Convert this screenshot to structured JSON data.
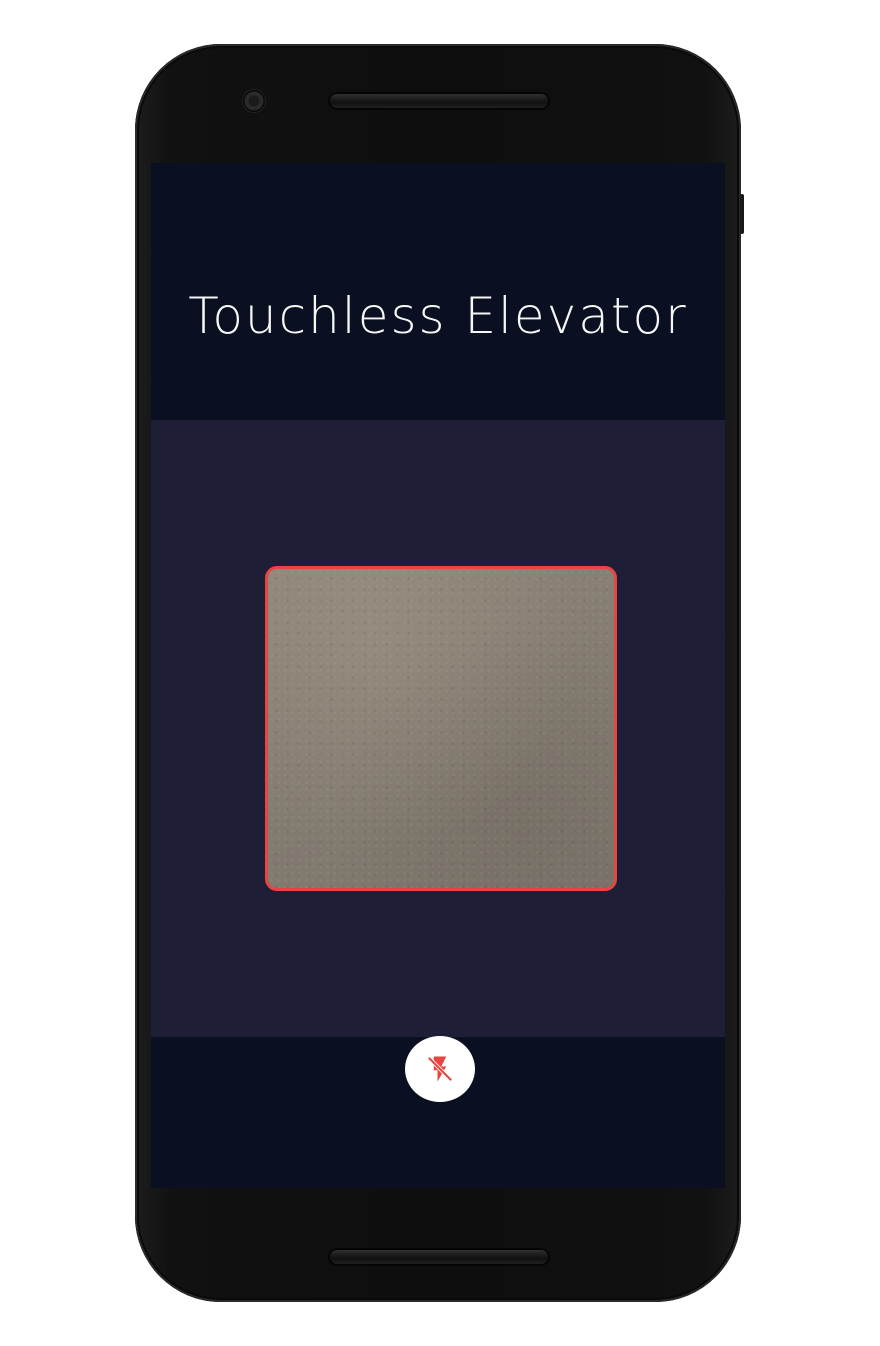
{
  "app": {
    "title": "Touchless Elevator"
  },
  "scanner": {
    "frame_color": "#e5463f"
  },
  "controls": {
    "flash_icon": "flash-off-icon",
    "flash_icon_color": "#e5463f"
  },
  "colors": {
    "header_background": "#0a0f21",
    "scanner_background": "#1e1f36",
    "bottom_bar_background": "#0a0f21"
  }
}
